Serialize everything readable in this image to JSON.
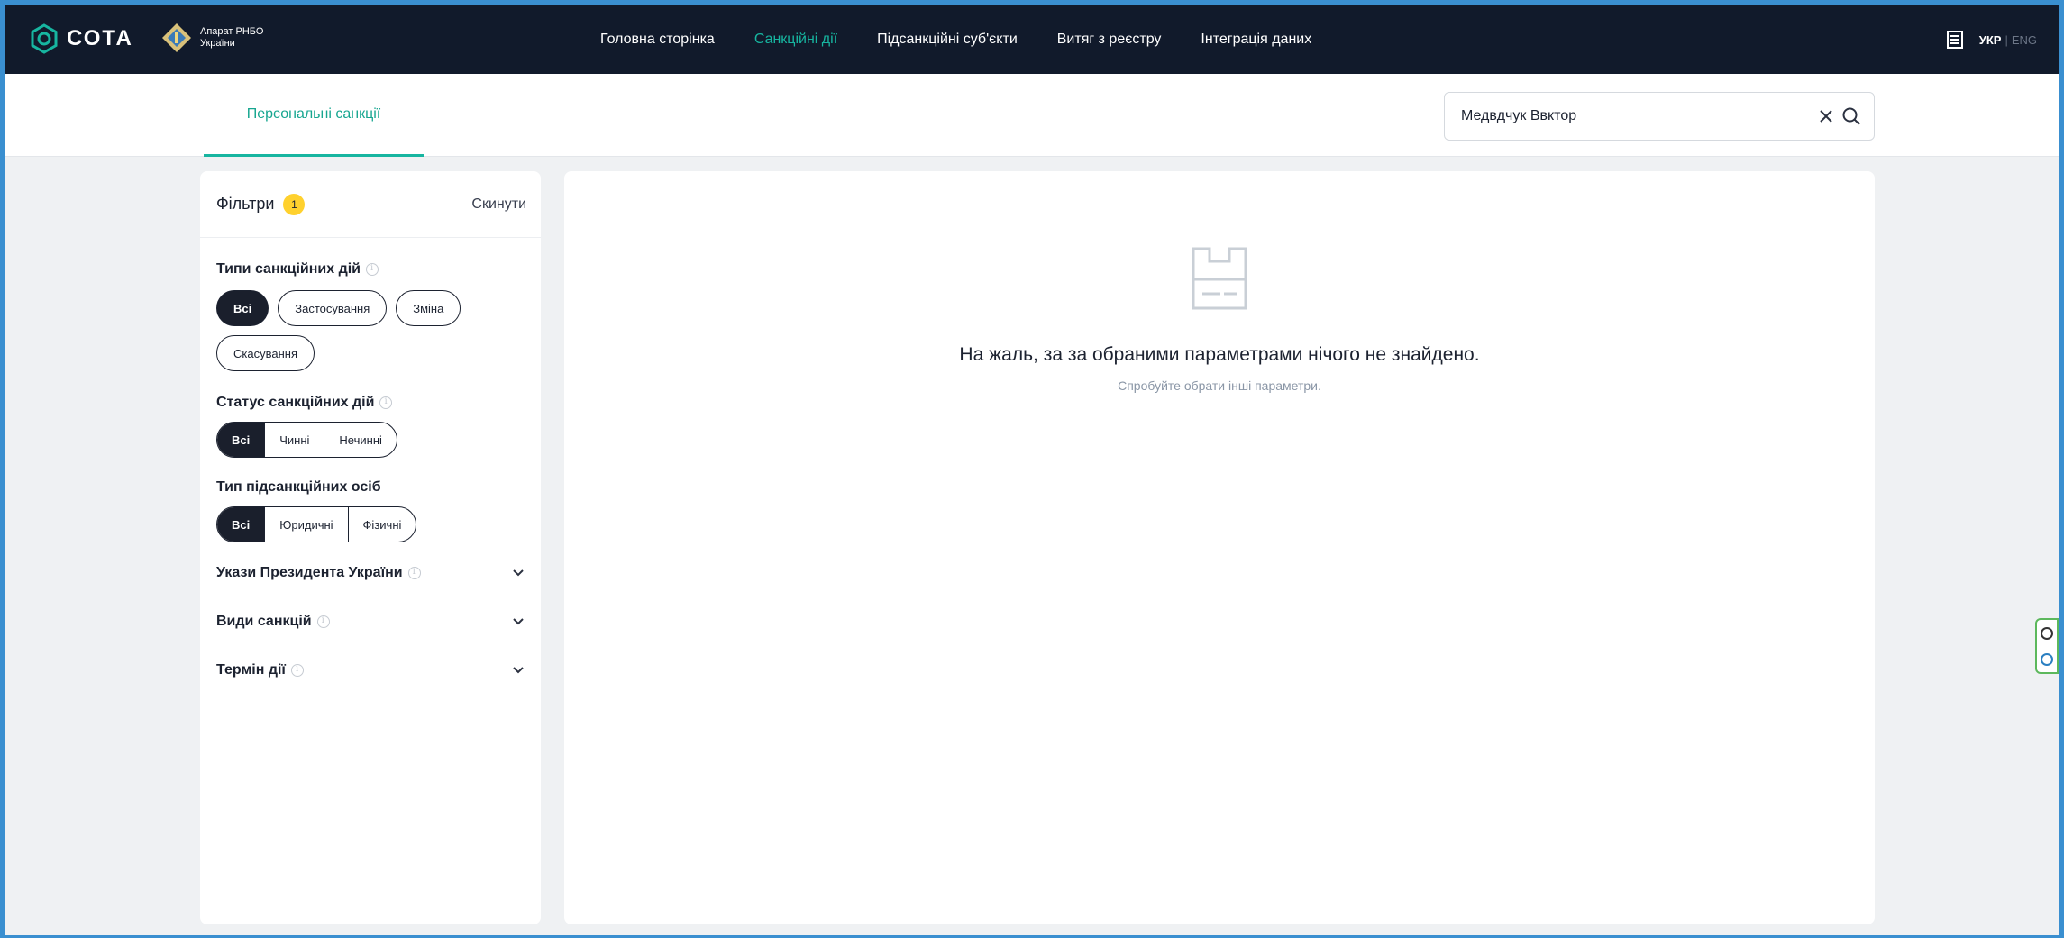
{
  "brand": {
    "name": "СОТА",
    "org_line1": "Апарат РНБО",
    "org_line2": "України"
  },
  "nav": [
    {
      "label": "Головна сторінка",
      "active": false
    },
    {
      "label": "Санкційні дії",
      "active": true
    },
    {
      "label": "Підсанкційні суб'єкти",
      "active": false
    },
    {
      "label": "Витяг з реєстру",
      "active": false
    },
    {
      "label": "Інтеграція даних",
      "active": false
    }
  ],
  "lang": {
    "current": "УКР",
    "separator": "|",
    "other": "ENG"
  },
  "tab": {
    "label": "Персональні санкції"
  },
  "search": {
    "value": "Медвдчук Ввктор",
    "placeholder": ""
  },
  "filters": {
    "title": "Фільтри",
    "count": "1",
    "reset": "Скинути",
    "sanction_types": {
      "title": "Типи санкційних дій",
      "options": [
        "Всі",
        "Застосування",
        "Зміна",
        "Скасування"
      ],
      "selected": "Всі"
    },
    "sanction_status": {
      "title": "Статус санкційних дій",
      "options": [
        "Всі",
        "Чинні",
        "Нечинні"
      ],
      "selected": "Всі"
    },
    "subject_type": {
      "title": "Тип підсанкційних осіб",
      "options": [
        "Всі",
        "Юридичні",
        "Фізичні"
      ],
      "selected": "Всі"
    },
    "decrees": {
      "title": "Укази Президента України"
    },
    "kinds": {
      "title": "Види санкцій"
    },
    "term": {
      "title": "Термін дії"
    }
  },
  "results": {
    "empty_title": "На жаль, за за обраними параметрами нічого не знайдено.",
    "empty_hint": "Спробуйте обрати інші параметри."
  },
  "colors": {
    "header_bg": "#111a2b",
    "accent": "#17b5a0",
    "badge": "#ffd12e"
  }
}
